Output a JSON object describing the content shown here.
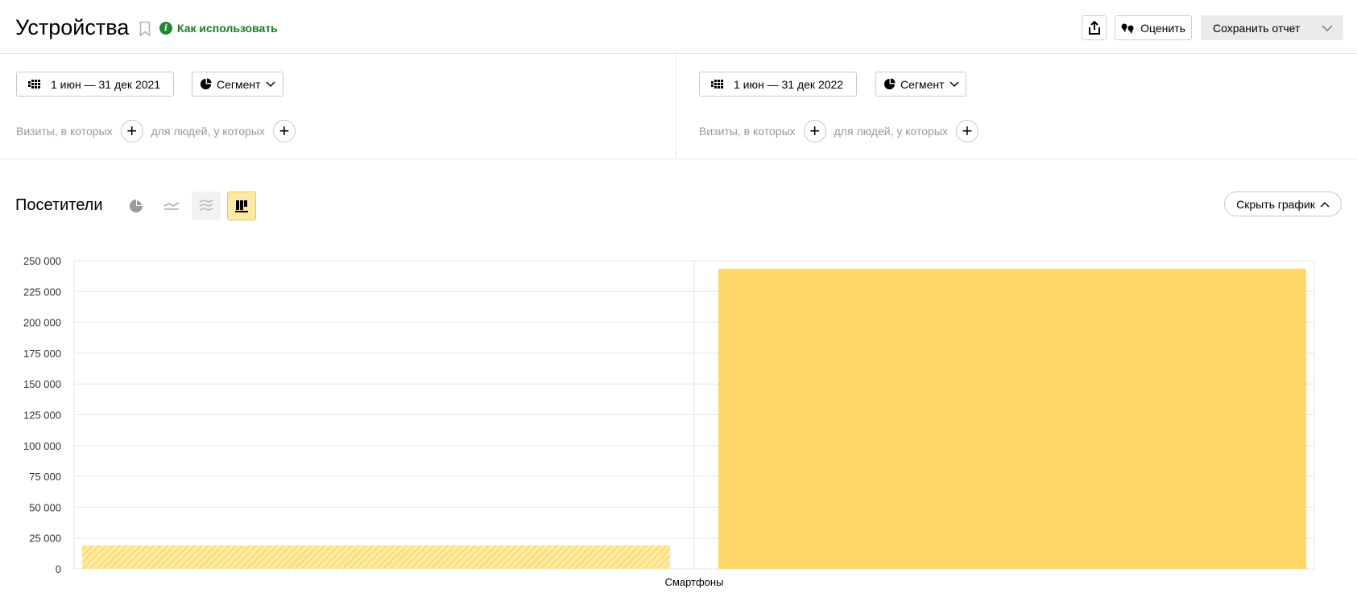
{
  "header": {
    "title": "Устройства",
    "howto_label": "Как использовать",
    "rate_label": "Оценить",
    "save_label": "Сохранить отчет"
  },
  "compare": {
    "left": {
      "date_range": "1 июн — 31 дек 2021",
      "segment_label": "Сегмент",
      "visits_label": "Визиты, в которых",
      "people_label": "для людей, у которых"
    },
    "right": {
      "date_range": "1 июн — 31 дек 2022",
      "segment_label": "Сегмент",
      "visits_label": "Визиты, в которых",
      "people_label": "для людей, у которых"
    }
  },
  "chart_section": {
    "title": "Посетители",
    "hide_label": "Скрыть график",
    "active_view": "bar"
  },
  "colors": {
    "accent": "#1a7a2a",
    "bar": "#fed766",
    "bar_hatched": "#fce38a",
    "grid": "#e6e6e6"
  },
  "chart_data": {
    "type": "bar",
    "categories": [
      "Смартфоны"
    ],
    "series": [
      {
        "period": "1 июн — 31 дек 2021",
        "values": [
          19000
        ],
        "style": "hatched"
      },
      {
        "period": "1 июн — 31 дек 2022",
        "values": [
          243500
        ],
        "style": "solid"
      }
    ],
    "yticks": [
      0,
      25000,
      50000,
      75000,
      100000,
      125000,
      150000,
      175000,
      200000,
      225000,
      250000
    ],
    "ytick_labels": [
      "0",
      "25 000",
      "50 000",
      "75 000",
      "100 000",
      "125 000",
      "150 000",
      "175 000",
      "200 000",
      "225 000",
      "250 000"
    ],
    "ylim": [
      0,
      250000
    ],
    "grid": true
  }
}
